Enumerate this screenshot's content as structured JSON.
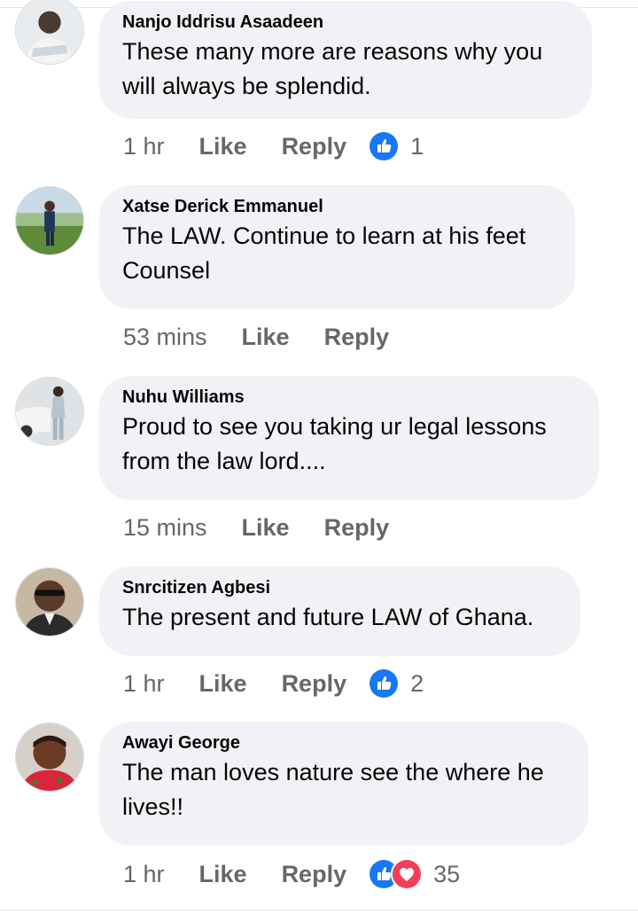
{
  "comments": [
    {
      "author": "Nanjo Iddrisu Asaadeen",
      "text": "These many more are reasons why you will always be splendid.",
      "time": "1 hr",
      "like": "Like",
      "reply": "Reply",
      "reaction_count": "1",
      "reactions": [
        "like-icon"
      ]
    },
    {
      "author": "Xatse Derick Emmanuel",
      "text": "The LAW. Continue to learn at his feet Counsel",
      "time": "53 mins",
      "like": "Like",
      "reply": "Reply"
    },
    {
      "author": "Nuhu Williams",
      "text": "Proud to see you taking ur legal lessons from the law lord....",
      "time": "15 mins",
      "like": "Like",
      "reply": "Reply"
    },
    {
      "author": "Snrcitizen Agbesi",
      "text": "The present and future LAW of Ghana.",
      "time": "1 hr",
      "like": "Like",
      "reply": "Reply",
      "reaction_count": "2",
      "reactions": [
        "like-icon"
      ]
    },
    {
      "author": "Awayi George",
      "text": "The man loves nature see the where he lives!!",
      "time": "1 hr",
      "like": "Like",
      "reply": "Reply",
      "reaction_count": "35",
      "reactions": [
        "like-icon",
        "love-icon"
      ]
    }
  ],
  "colors": {
    "bubble": "#f0f2f5",
    "meta_text": "#65676b",
    "like_blue": "#1877f2",
    "love_red": "#f33e58"
  }
}
